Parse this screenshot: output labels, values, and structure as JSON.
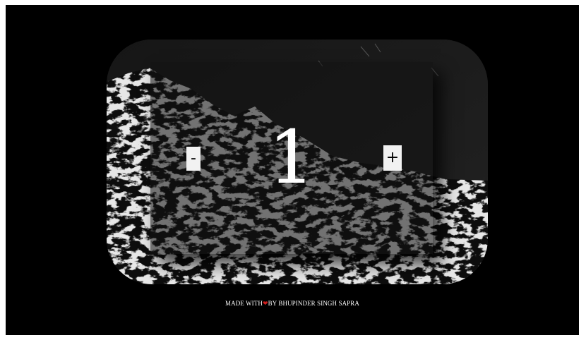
{
  "counter": {
    "decrement_label": "-",
    "increment_label": "+",
    "value": "1"
  },
  "footer": {
    "prefix": "MADE WITH",
    "heart_icon": "heart-icon",
    "heart_glyph": "❤",
    "suffix": "BY BHUPINDER SINGH SAPRA"
  },
  "colors": {
    "page_border": "#ffffff",
    "background": "#000000",
    "button": "#f2f2f2",
    "heart": "#d21d1d"
  }
}
